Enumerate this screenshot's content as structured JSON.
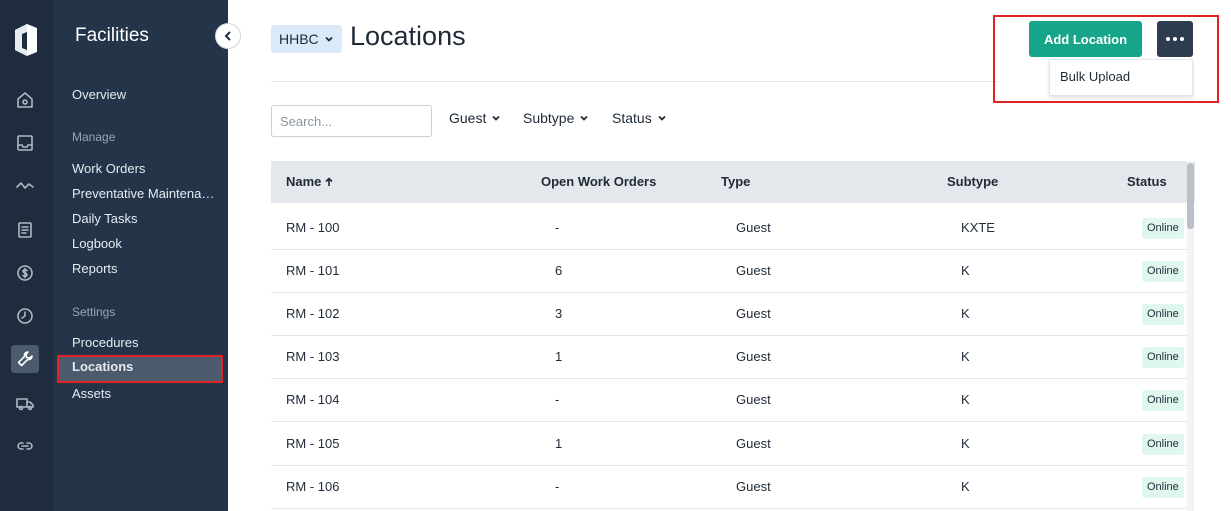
{
  "sidebar": {
    "title": "Facilities",
    "overview": "Overview",
    "manage_label": "Manage",
    "manage_items": [
      "Work Orders",
      "Preventative Maintenance",
      "Daily Tasks",
      "Logbook",
      "Reports"
    ],
    "settings_label": "Settings",
    "settings_items": [
      "Procedures",
      "Locations",
      "Assets"
    ],
    "active_item": "Locations"
  },
  "rail": {
    "icons": [
      "logo-icon",
      "home-icon",
      "inbox-icon",
      "activity-icon",
      "document-icon",
      "dollar-icon",
      "clock-icon",
      "wrench-icon",
      "truck-icon",
      "link-icon"
    ],
    "active": "wrench-icon"
  },
  "header": {
    "property": "HHBC",
    "title": "Locations",
    "add_button": "Add Location",
    "menu_items": [
      "Bulk Upload"
    ]
  },
  "filters": {
    "search_placeholder": "Search...",
    "guest": "Guest",
    "subtype": "Subtype",
    "status": "Status"
  },
  "table": {
    "columns": [
      "Name",
      "Open Work Orders",
      "Type",
      "Subtype",
      "Status"
    ],
    "rows": [
      {
        "name": "RM - 100",
        "open": "-",
        "type": "Guest",
        "subtype": "KXTE",
        "status": "Online"
      },
      {
        "name": "RM - 101",
        "open": "6",
        "type": "Guest",
        "subtype": "K",
        "status": "Online"
      },
      {
        "name": "RM - 102",
        "open": "3",
        "type": "Guest",
        "subtype": "K",
        "status": "Online"
      },
      {
        "name": "RM - 103",
        "open": "1",
        "type": "Guest",
        "subtype": "K",
        "status": "Online"
      },
      {
        "name": "RM - 104",
        "open": "-",
        "type": "Guest",
        "subtype": "K",
        "status": "Online"
      },
      {
        "name": "RM - 105",
        "open": "1",
        "type": "Guest",
        "subtype": "K",
        "status": "Online"
      },
      {
        "name": "RM - 106",
        "open": "-",
        "type": "Guest",
        "subtype": "K",
        "status": "Online"
      }
    ]
  },
  "colors": {
    "rail_bg": "#1e2c3e",
    "sidebar_bg": "#24354a",
    "accent_green": "#17a589",
    "highlight_red": "#e02424",
    "badge_bg": "#dff7ef"
  }
}
